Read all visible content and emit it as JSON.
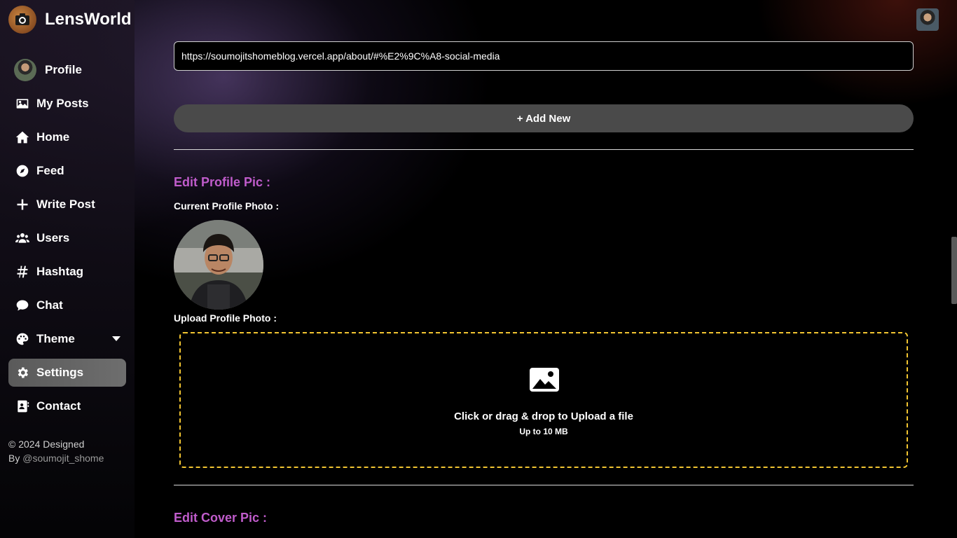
{
  "brand": {
    "name": "LensWorld",
    "logo_icon": "camera-icon"
  },
  "sidebar": {
    "items": [
      {
        "label": "Profile",
        "icon": "avatar"
      },
      {
        "label": "My Posts",
        "icon": "image-icon"
      },
      {
        "label": "Home",
        "icon": "home-icon"
      },
      {
        "label": "Feed",
        "icon": "compass-icon"
      },
      {
        "label": "Write Post",
        "icon": "plus-icon"
      },
      {
        "label": "Users",
        "icon": "users-icon"
      },
      {
        "label": "Hashtag",
        "icon": "hashtag-icon"
      },
      {
        "label": "Chat",
        "icon": "chat-icon"
      },
      {
        "label": "Theme",
        "icon": "palette-icon"
      },
      {
        "label": "Settings",
        "icon": "gear-icon",
        "active": true
      },
      {
        "label": "Contact",
        "icon": "contact-card-icon"
      }
    ],
    "footer": {
      "line1": "© 2024 Designed",
      "line2_prefix": "By ",
      "handle": "@soumojit_shome"
    }
  },
  "main": {
    "social_link_value": "https://soumojitshomeblog.vercel.app/about/#%E2%9C%A8-social-media",
    "add_new_label": "+ Add New",
    "profile_pic": {
      "title": "Edit Profile Pic :",
      "current_label": "Current Profile Photo :",
      "upload_label": "Upload Profile Photo :",
      "dropzone_text": "Click or drag & drop to Upload a file",
      "dropzone_subtext": "Up to 10 MB"
    },
    "cover_pic": {
      "title": "Edit Cover Pic :"
    }
  },
  "colors": {
    "accent": "#c05ccb",
    "dropzone_border": "#f2c531",
    "active_bg": "#616161"
  }
}
